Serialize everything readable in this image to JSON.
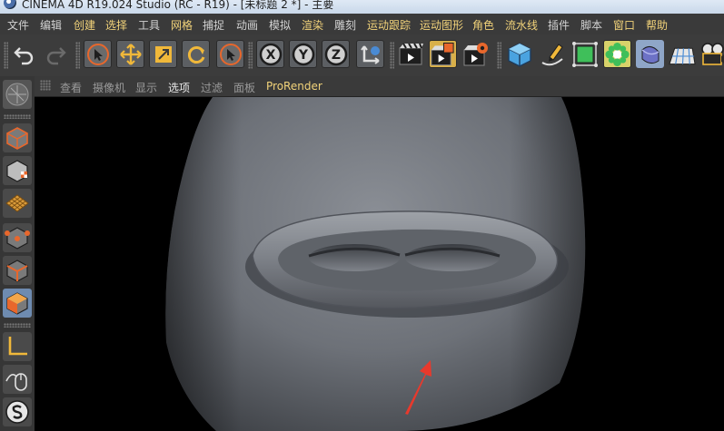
{
  "window": {
    "title": "CINEMA 4D R19.024 Studio (RC - R19) - [未标题 2 *] - 主要"
  },
  "menu": {
    "items": [
      {
        "label": "文件"
      },
      {
        "label": "编辑"
      },
      {
        "label": "创建"
      },
      {
        "label": "选择"
      },
      {
        "label": "工具"
      },
      {
        "label": "网格"
      },
      {
        "label": "捕捉"
      },
      {
        "label": "动画"
      },
      {
        "label": "模拟"
      },
      {
        "label": "渲染"
      },
      {
        "label": "雕刻"
      },
      {
        "label": "运动跟踪"
      },
      {
        "label": "运动图形"
      },
      {
        "label": "角色"
      },
      {
        "label": "流水线"
      },
      {
        "label": "插件"
      },
      {
        "label": "脚本"
      },
      {
        "label": "窗口"
      },
      {
        "label": "帮助"
      }
    ]
  },
  "toolbar": {
    "axis_x": "X",
    "axis_y": "Y",
    "axis_z": "Z",
    "icons": [
      "undo-icon",
      "redo-icon",
      "live-select-icon",
      "move-icon",
      "scale-icon",
      "rotate-icon",
      "recent-tool-icon",
      "lock-x-icon",
      "lock-y-icon",
      "lock-z-icon",
      "coordinate-system-icon",
      "render-view-icon",
      "render-picture-viewer-icon",
      "render-settings-icon",
      "cube-icon",
      "pen-icon",
      "subdivision-icon",
      "cloner-icon",
      "deformer-icon",
      "floor-icon",
      "camera-icon"
    ]
  },
  "left_palette": {
    "icons": [
      "workplane-icon",
      "model-mode-icon",
      "texture-mode-icon",
      "workplane-grid-icon",
      "points-mode-icon",
      "edges-mode-icon",
      "polygons-mode-icon",
      "axis-mode-icon",
      "tweak-mode-icon",
      "snap-icon"
    ]
  },
  "view_menu": {
    "items": [
      {
        "label": "查看"
      },
      {
        "label": "摄像机"
      },
      {
        "label": "显示"
      },
      {
        "label": "选项"
      },
      {
        "label": "过滤"
      },
      {
        "label": "面板"
      },
      {
        "label": "ProRender"
      }
    ]
  },
  "colors": {
    "menu_text": "#d2d2d2",
    "menu_highlight": "#f2d37a",
    "viewport_bg": "#000000",
    "model_gray": "#6f737a",
    "annotation_arrow": "#e8392c"
  }
}
